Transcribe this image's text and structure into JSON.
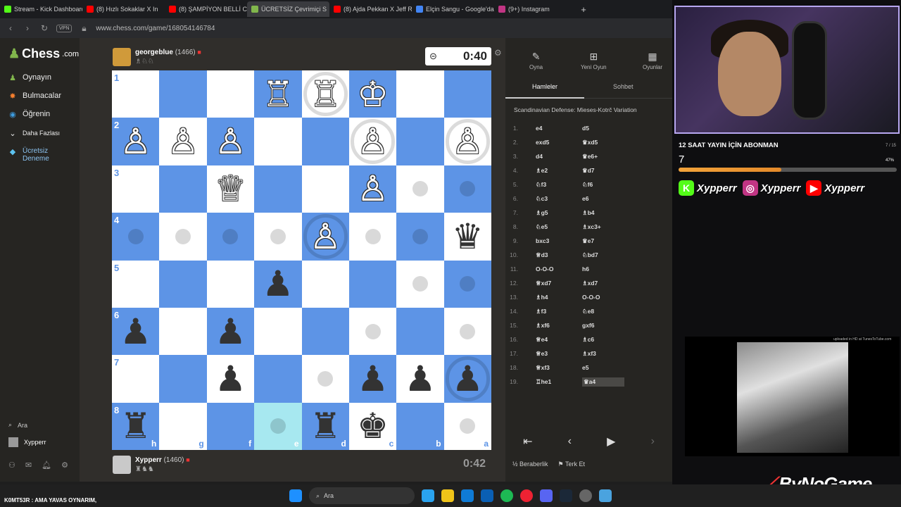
{
  "browser": {
    "tabs": [
      {
        "label": "Stream - Kick Dashboard",
        "color": "#53fc18"
      },
      {
        "label": "(8) Hızlı Sokaklar X In",
        "color": "#ff0000"
      },
      {
        "label": "(8) ŞAMPİYON BELLİ C",
        "color": "#ff0000"
      },
      {
        "label": "ÜCRETSİZ Çevrimiçi S",
        "color": "#81b64c"
      },
      {
        "label": "(8) Ajda Pekkan X Jeff Red",
        "color": "#ff0000"
      },
      {
        "label": "Elçin Sangu - Google'da A",
        "color": "#4285f4"
      },
      {
        "label": "(9+) Instagram",
        "color": "#c13584"
      }
    ],
    "new_tab": "+",
    "vpn": "VPN",
    "url": "www.chess.com/game/168054146784"
  },
  "sidebar": {
    "logo": "Chess",
    "logo_suffix": ".com",
    "items": [
      {
        "label": "Oynayın",
        "icon": "♟"
      },
      {
        "label": "Bulmacalar",
        "icon": "✸"
      },
      {
        "label": "Öğrenin",
        "icon": "◉"
      },
      {
        "label": "Daha Fazlası",
        "icon": "⌄"
      },
      {
        "label": "Ücretsiz",
        "label2": "Deneme",
        "icon": "◆"
      }
    ],
    "search": "Ara",
    "user": "Xypperr"
  },
  "top_player": {
    "name": "georgeblue",
    "rating": "(1466)",
    "clock": "0:40"
  },
  "bottom_player": {
    "name": "Xypperr",
    "rating": "(1460)",
    "clock": "0:42"
  },
  "board": {
    "ranks": [
      "1",
      "2",
      "3",
      "4",
      "5",
      "6",
      "7",
      "8"
    ],
    "files": [
      "h",
      "g",
      "f",
      "e",
      "d",
      "c",
      "b",
      "a"
    ],
    "rows": [
      [
        "",
        "",
        "",
        "wR",
        "wR",
        "wK",
        "",
        ""
      ],
      [
        "wP",
        "wP",
        "wP",
        "",
        "",
        "wP",
        "",
        "wP"
      ],
      [
        "",
        "",
        "wQ",
        "",
        "",
        "wP",
        "",
        ""
      ],
      [
        "",
        "",
        "",
        "",
        "wP",
        "",
        "",
        "bQ"
      ],
      [
        "",
        "",
        "",
        "bP",
        "",
        "",
        "",
        ""
      ],
      [
        "bP",
        "",
        "bP",
        "",
        "",
        "",
        "",
        ""
      ],
      [
        "",
        "",
        "bP",
        "",
        "",
        "bP",
        "bP",
        "bP"
      ],
      [
        "bR",
        "",
        "",
        "",
        "bR",
        "bK",
        "",
        ""
      ]
    ],
    "dots": [
      [
        2,
        6
      ],
      [
        2,
        7
      ],
      [
        3,
        0
      ],
      [
        3,
        1
      ],
      [
        3,
        2
      ],
      [
        3,
        3
      ],
      [
        3,
        5
      ],
      [
        3,
        6
      ],
      [
        4,
        6
      ],
      [
        4,
        7
      ],
      [
        5,
        5
      ],
      [
        5,
        7
      ],
      [
        6,
        4
      ],
      [
        7,
        3
      ],
      [
        7,
        7
      ]
    ],
    "rings": [
      [
        0,
        4
      ],
      [
        1,
        5
      ],
      [
        1,
        7
      ],
      [
        3,
        4
      ],
      [
        6,
        7
      ]
    ],
    "highlight": [
      [
        7,
        3
      ]
    ]
  },
  "panel": {
    "buttons": [
      {
        "label": "Oyna",
        "icon": "✎"
      },
      {
        "label": "Yeni Oyun",
        "icon": "⊞"
      },
      {
        "label": "Oyunlar",
        "icon": "▦"
      }
    ],
    "tab_moves": "Hamleler",
    "tab_chat": "Sohbet",
    "opening": "Scandinavian Defense: Mieses-Kotrč Variation",
    "moves": [
      [
        "1.",
        "e4",
        "d5"
      ],
      [
        "2.",
        "exd5",
        "♛xd5"
      ],
      [
        "3.",
        "d4",
        "♛e6+"
      ],
      [
        "4.",
        "♗e2",
        "♛d7"
      ],
      [
        "5.",
        "♘f3",
        "♘f6"
      ],
      [
        "6.",
        "♘c3",
        "e6"
      ],
      [
        "7.",
        "♗g5",
        "♗b4"
      ],
      [
        "8.",
        "♘e5",
        "♗xc3+"
      ],
      [
        "9.",
        "bxc3",
        "♛e7"
      ],
      [
        "10.",
        "♕d3",
        "♘bd7"
      ],
      [
        "11.",
        "O-O-O",
        "h6"
      ],
      [
        "12.",
        "♕xd7",
        "♗xd7"
      ],
      [
        "13.",
        "♗h4",
        "O-O-O"
      ],
      [
        "14.",
        "♗f3",
        "♘e8"
      ],
      [
        "15.",
        "♗xf6",
        "gxf6"
      ],
      [
        "16.",
        "♕e4",
        "♗c6"
      ],
      [
        "17.",
        "♕e3",
        "♗xf3"
      ],
      [
        "18.",
        "♕xf3",
        "e5"
      ],
      [
        "19.",
        "♖he1",
        "♛a4"
      ]
    ],
    "draw": "Beraberlik",
    "resign": "Terk Et"
  },
  "overlay": {
    "sub_title": "12 SAAT YAYIN İÇİN ABONMAN",
    "sub_count": "7",
    "sub_fraction": "7 / 15",
    "sub_percent": "47%",
    "sub_progress": 0.47,
    "handles": [
      {
        "platform": "K",
        "handle": "Xypperr",
        "color": "#53fc18"
      },
      {
        "platform": "◎",
        "handle": "Xypperr",
        "color": "#c13584"
      },
      {
        "platform": "▶",
        "handle": "Xypperr",
        "color": "#ff0000"
      }
    ],
    "uploaded": "uploaded in HD at TunesToTube.com",
    "brand": "ByNoGame",
    "ticker": "K0MT53R : AMA YAVAS OYNARIM,"
  },
  "taskbar": {
    "search": "Ara"
  }
}
